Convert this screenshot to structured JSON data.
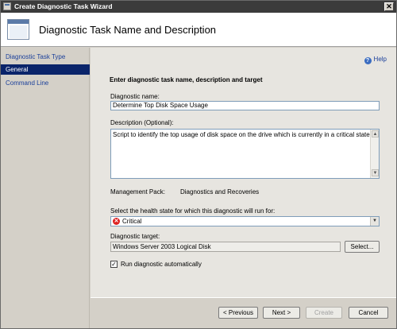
{
  "window": {
    "title": "Create Diagnostic Task Wizard",
    "close_glyph": "✕"
  },
  "header": {
    "title": "Diagnostic Task Name and Description"
  },
  "nav": {
    "items": [
      {
        "label": "Diagnostic Task Type"
      },
      {
        "label": "General"
      },
      {
        "label": "Command Line"
      }
    ],
    "selected": "General"
  },
  "help": {
    "label": "Help",
    "icon": "help-icon"
  },
  "form": {
    "section_heading": "Enter diagnostic task name, description and target",
    "name_label": "Diagnostic name:",
    "name_value": "Determine Top Disk Space Usage",
    "description_label": "Description (Optional):",
    "description_value": "Script to identify the top usage of disk space on the drive which is currently in a critical state.",
    "management_pack_label": "Management Pack:",
    "management_pack_value": "Diagnostics and Recoveries",
    "health_state_label": "Select the health state for which this diagnostic will run for:",
    "health_state_value": "Critical",
    "target_label": "Diagnostic target:",
    "target_value": "Windows Server 2003 Logical Disk",
    "select_button": "Select...",
    "run_auto_label": "Run diagnostic automatically",
    "run_auto_checked": true
  },
  "footer": {
    "previous": "< Previous",
    "next": "Next >",
    "create": "Create",
    "cancel": "Cancel"
  },
  "colors": {
    "nav_selected": "#0a246a",
    "link": "#1a3f9a",
    "critical": "#dd2222"
  }
}
